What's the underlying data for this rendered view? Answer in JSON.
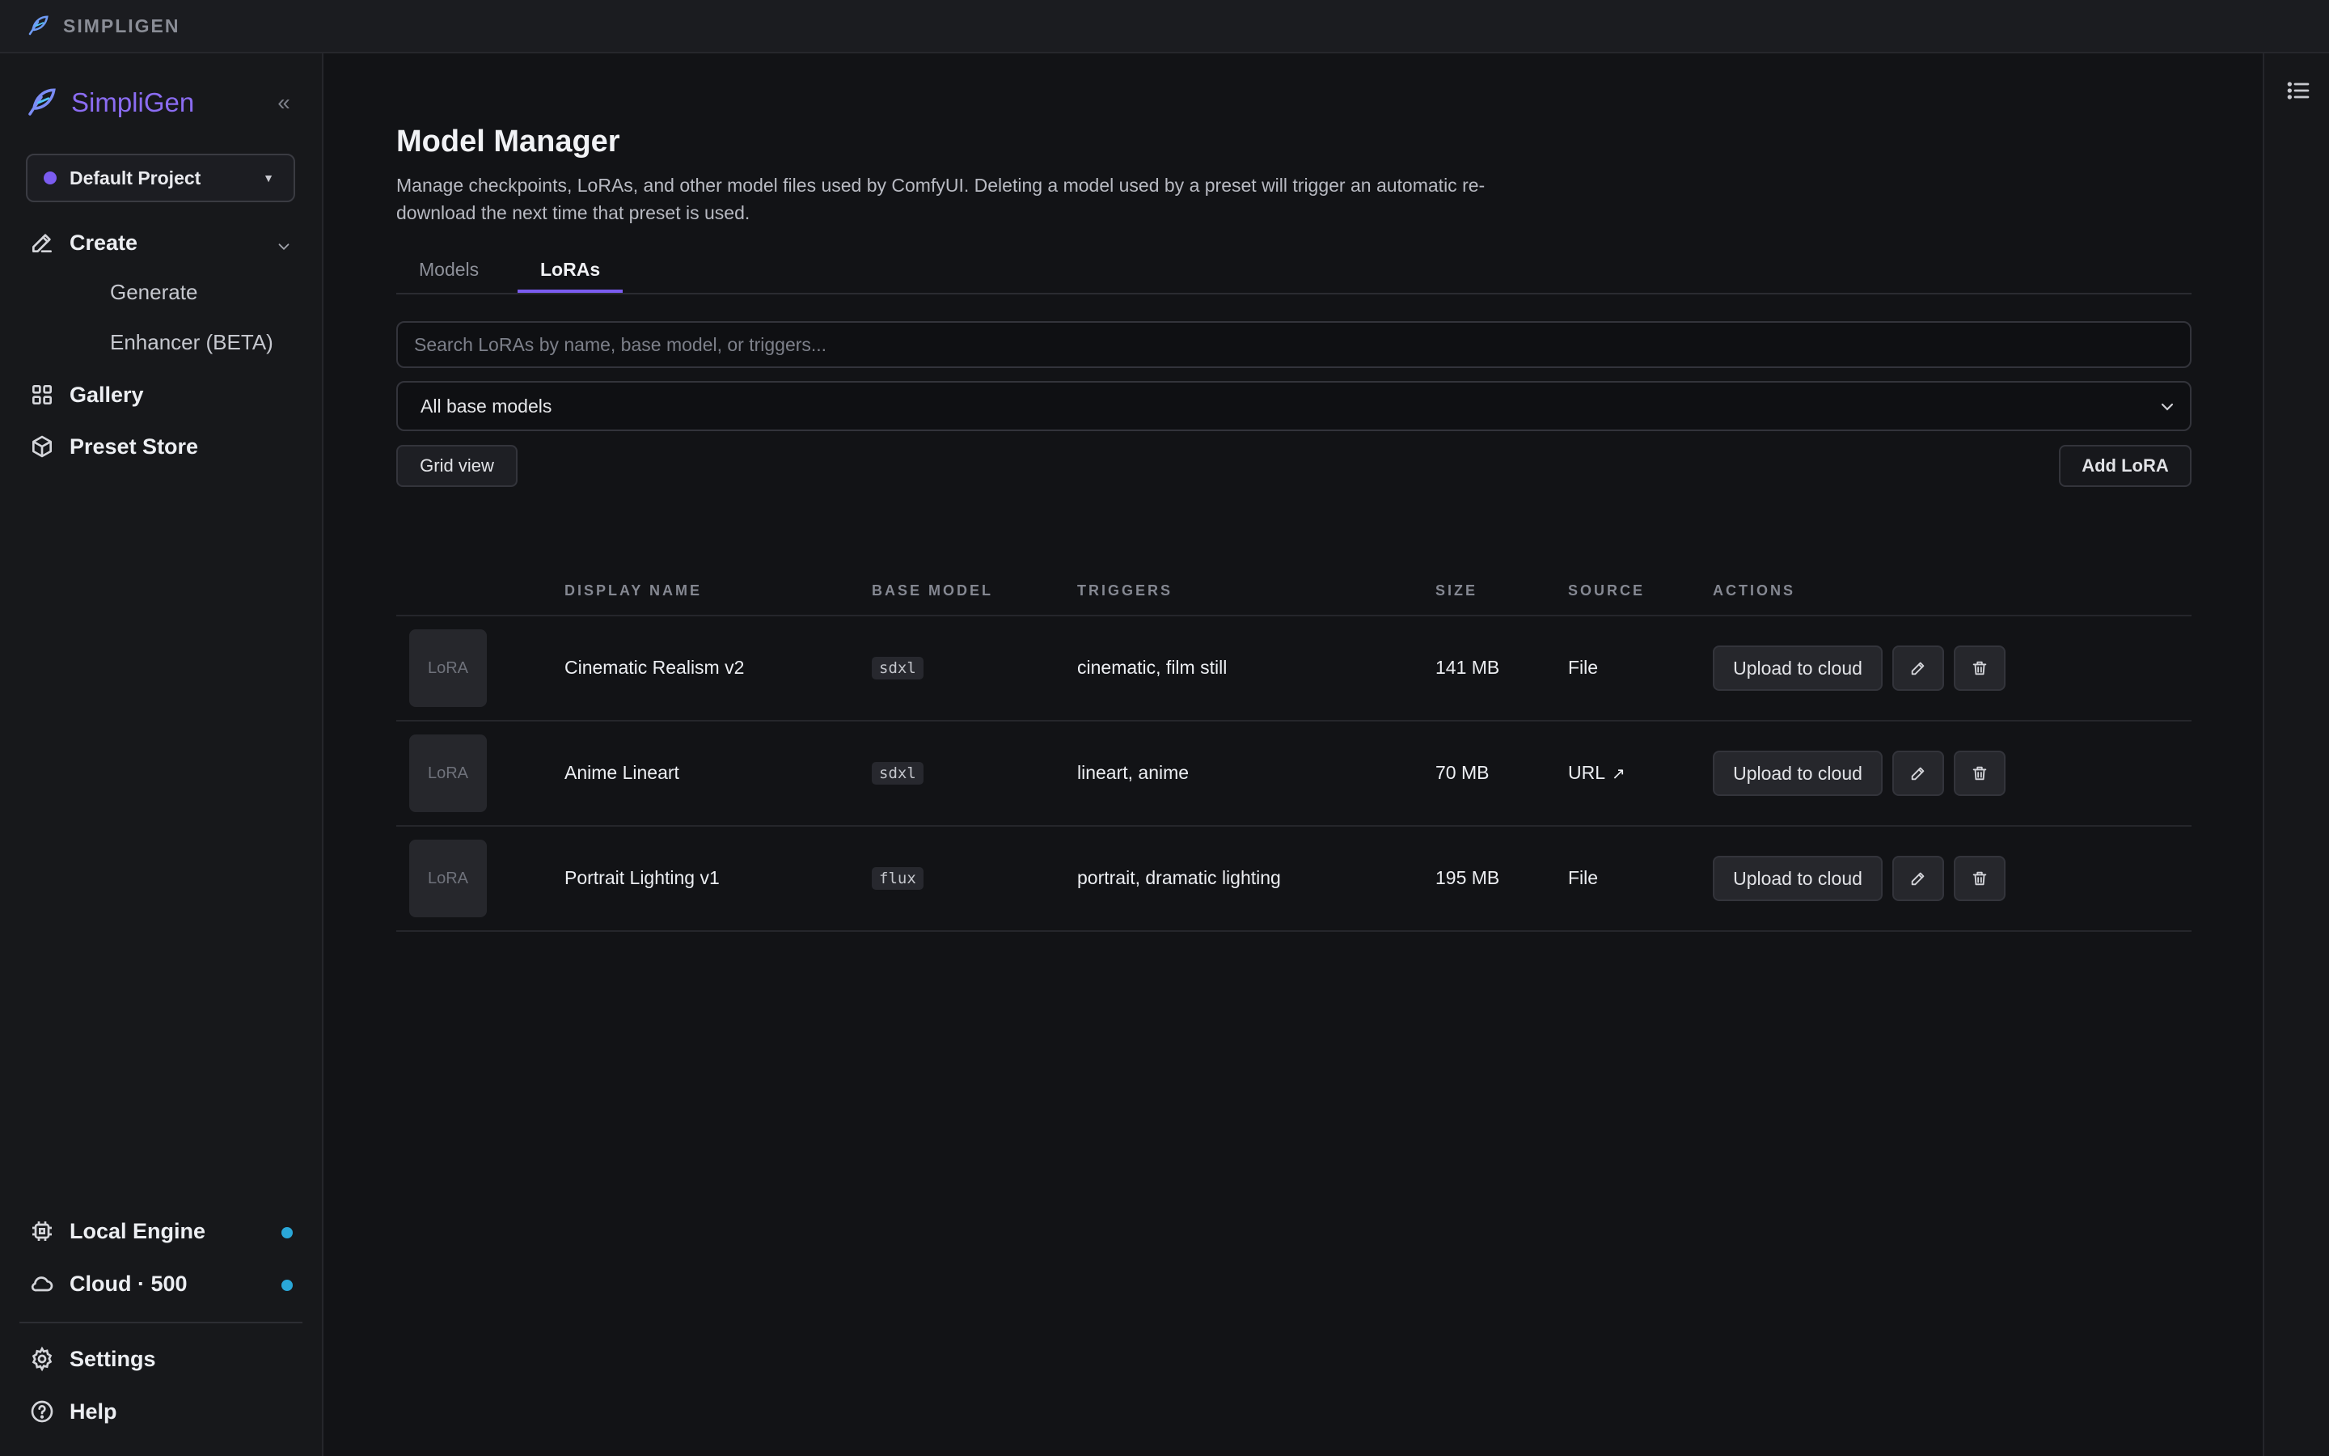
{
  "topbar": {
    "brand": "SIMPLIGEN",
    "logo_icon": "feather-logo-icon"
  },
  "sidebar": {
    "app_name": "SimpliGen",
    "collapse_label": "«",
    "project": {
      "name": "Default Project",
      "dot_color": "#7b5cf0"
    },
    "create": {
      "label": "Create",
      "icon": "pencil-icon"
    },
    "sub_items": [
      {
        "label": "Generate"
      },
      {
        "label": "Enhancer (BETA)"
      }
    ],
    "gallery": {
      "label": "Gallery",
      "icon": "grid-icon"
    },
    "preset_store": {
      "label": "Preset Store",
      "icon": "cube-icon"
    },
    "local_engine": {
      "label": "Local Engine",
      "icon": "chip-icon",
      "status_color": "#2aa7d8"
    },
    "cloud": {
      "label": "Cloud · 500",
      "icon": "cloud-icon",
      "status_color": "#2aa7d8"
    },
    "settings": {
      "label": "Settings",
      "icon": "gear-icon"
    },
    "help": {
      "label": "Help",
      "icon": "help-icon"
    }
  },
  "main": {
    "title": "Model Manager",
    "description": "Manage checkpoints, LoRAs, and other model files used by ComfyUI. Deleting a model used by a preset will trigger an automatic re-download the next time that preset is used.",
    "tabs": [
      {
        "label": "Models",
        "active": false
      },
      {
        "label": "LoRAs",
        "active": true
      }
    ],
    "search": {
      "placeholder": "Search LoRAs by name, base model, or triggers...",
      "value": ""
    },
    "filter": {
      "selected": "All base models"
    },
    "grid_view_label": "Grid view",
    "add_lora_label": "Add LoRA",
    "accent_color": "#7b5cf0"
  },
  "table": {
    "headers": {
      "display_name": "DISPLAY NAME",
      "base_model": "BASE MODEL",
      "triggers": "TRIGGERS",
      "size": "SIZE",
      "source": "SOURCE",
      "actions": "ACTIONS"
    },
    "rows": [
      {
        "thumb": "LoRA",
        "name": "Cinematic Realism v2",
        "base_model": "sdxl",
        "triggers": "cinematic, film still",
        "size": "141 MB",
        "source": "File",
        "upload_label": "Upload to cloud"
      },
      {
        "thumb": "LoRA",
        "name": "Anime Lineart",
        "base_model": "sdxl",
        "triggers": "lineart, anime",
        "size": "70 MB",
        "source": "URL",
        "source_link": "↗",
        "upload_label": "Upload to cloud"
      },
      {
        "thumb": "LoRA",
        "name": "Portrait Lighting v1",
        "base_model": "flux",
        "triggers": "portrait, dramatic lighting",
        "size": "195 MB",
        "source": "File",
        "upload_label": "Upload to cloud"
      }
    ]
  }
}
